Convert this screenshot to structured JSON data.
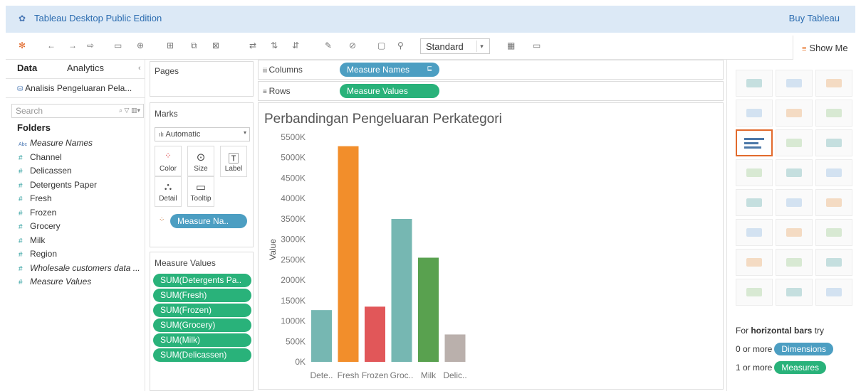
{
  "titlebar": {
    "app_title": "Tableau Desktop Public Edition",
    "buy_label": "Buy Tableau"
  },
  "toolbar": {
    "mark_size_select": "Standard",
    "show_me_label": "Show Me"
  },
  "data_pane": {
    "tab_data": "Data",
    "tab_analytics": "Analytics",
    "datasource": "Analisis Pengeluaran Pela...",
    "search_placeholder": "Search",
    "folders_label": "Folders",
    "fields": [
      {
        "name": "Measure Names",
        "type": "abc",
        "italic": true
      },
      {
        "name": "Channel",
        "type": "#",
        "italic": false
      },
      {
        "name": "Delicassen",
        "type": "#",
        "italic": false
      },
      {
        "name": "Detergents Paper",
        "type": "#",
        "italic": false
      },
      {
        "name": "Fresh",
        "type": "#",
        "italic": false
      },
      {
        "name": "Frozen",
        "type": "#",
        "italic": false
      },
      {
        "name": "Grocery",
        "type": "#",
        "italic": false
      },
      {
        "name": "Milk",
        "type": "#",
        "italic": false
      },
      {
        "name": "Region",
        "type": "#",
        "italic": false
      },
      {
        "name": "Wholesale customers data ...",
        "type": "#",
        "italic": true
      },
      {
        "name": "Measure Values",
        "type": "#",
        "italic": true
      }
    ]
  },
  "pages_card": {
    "title": "Pages"
  },
  "marks_card": {
    "title": "Marks",
    "mark_type": "Automatic",
    "buttons": {
      "color": "Color",
      "size": "Size",
      "label": "Label",
      "detail": "Detail",
      "tooltip": "Tooltip"
    },
    "color_pill": "Measure Na.."
  },
  "measure_values_card": {
    "title": "Measure Values",
    "pills": [
      "SUM(Detergents Pa..",
      "SUM(Fresh)",
      "SUM(Frozen)",
      "SUM(Grocery)",
      "SUM(Milk)",
      "SUM(Delicassen)"
    ]
  },
  "shelves": {
    "columns_label": "Columns",
    "columns_pill": "Measure Names",
    "rows_label": "Rows",
    "rows_pill": "Measure Values"
  },
  "chart_data": {
    "type": "bar",
    "title": "Perbandingan Pengeluaran Perkategori",
    "ylabel": "Value",
    "xlabel": "",
    "ylim": [
      0,
      5500000
    ],
    "yticks": [
      0,
      500000,
      1000000,
      1500000,
      2000000,
      2500000,
      3000000,
      3500000,
      4000000,
      4500000,
      5000000,
      5500000
    ],
    "ytick_labels": [
      "0K",
      "500K",
      "1000K",
      "1500K",
      "2000K",
      "2500K",
      "3000K",
      "3500K",
      "4000K",
      "4500K",
      "5000K",
      "5500K"
    ],
    "categories": [
      "Dete..",
      "Fresh",
      "Frozen",
      "Groc..",
      "Milk",
      "Delic.."
    ],
    "values": [
      1267857,
      5280131,
      1351650,
      3498562,
      2550357,
      670943
    ],
    "colors": [
      "#76b7b2",
      "#f28e2b",
      "#e15759",
      "#76b7b2",
      "#59a14f",
      "#bab0ac"
    ],
    "grid": false
  },
  "show_me": {
    "hint_prefix": "For ",
    "hint_bold": "horizontal bars",
    "hint_suffix": " try",
    "dims_prefix": "0 or more",
    "dims_pill": "Dimensions",
    "meas_prefix": "1 or more",
    "meas_pill": "Measures"
  },
  "colors": {
    "accent_blue": "#4c9ec2",
    "accent_green": "#29b27a",
    "active_orange": "#e26a2c"
  }
}
